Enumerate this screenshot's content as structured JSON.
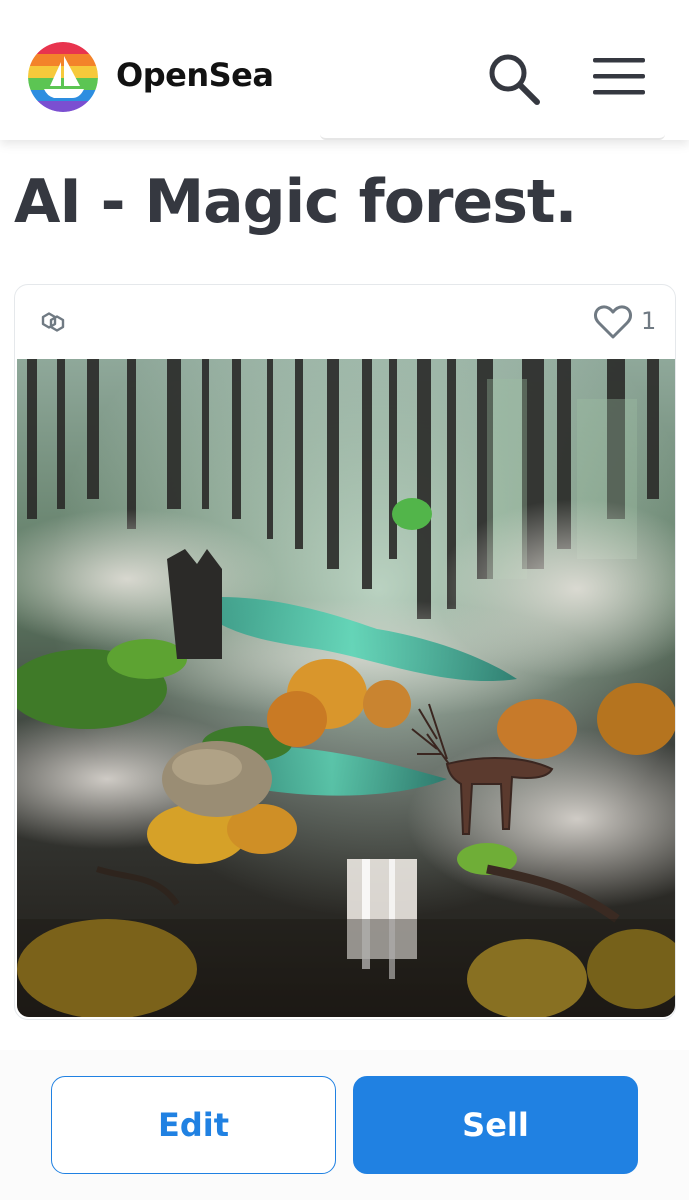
{
  "header": {
    "brand": "OpenSea",
    "logo_icon": "opensea-sailboat-logo",
    "search_icon": "search-icon",
    "menu_icon": "hamburger-menu-icon"
  },
  "asset": {
    "title": "AI - Magic forest.",
    "chain_icon": "polygon-chain-icon",
    "favorites_icon": "heart-outline-icon",
    "favorites_count": "1",
    "image_subject": "artwork"
  },
  "actions": {
    "edit_label": "Edit",
    "sell_label": "Sell"
  },
  "colors": {
    "accent": "#2081e2",
    "title_text": "#353840",
    "brand_text": "#121212",
    "muted": "#707a83",
    "border": "#e5e8eb"
  }
}
